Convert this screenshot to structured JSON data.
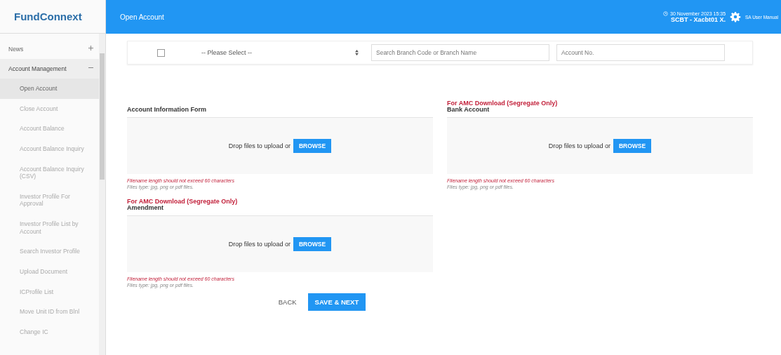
{
  "logo": "FundConnext",
  "header": {
    "page_title": "Open Account",
    "datetime": "30 November 2023 15:35",
    "user": "SCBT - Xacbt01 X.",
    "manual_link": "SA User Manual"
  },
  "sidebar": {
    "items": [
      {
        "label": "News",
        "expanded": false,
        "selected": false
      },
      {
        "label": "Account Management",
        "expanded": true,
        "selected": false,
        "children": [
          {
            "label": "Open Account",
            "selected": true
          },
          {
            "label": "Close Account",
            "selected": false
          },
          {
            "label": "Account Balance",
            "selected": false
          },
          {
            "label": "Account Balance Inquiry",
            "selected": false
          },
          {
            "label": "Account Balance Inquiry (CSV)",
            "selected": false
          },
          {
            "label": "Investor Profile For Approval",
            "selected": false
          },
          {
            "label": "Investor Profile List by Account",
            "selected": false
          },
          {
            "label": "Search Investor Profile",
            "selected": false
          },
          {
            "label": "Upload Document",
            "selected": false
          },
          {
            "label": "ICProfile List",
            "selected": false
          },
          {
            "label": "Move Unit ID from Blnl",
            "selected": false
          },
          {
            "label": "Change IC",
            "selected": false
          }
        ]
      }
    ]
  },
  "bank_row": {
    "checked": false,
    "select": "-- Please Select --",
    "branch_placeholder": "Search Branch Code or Branch Name",
    "account_placeholder": "Account No."
  },
  "uploads": [
    {
      "label": "Account Information Form",
      "drop_text": "Drop files to upload or",
      "browse": "BROWSE",
      "rule": "Filename length should not exceed 60 characters",
      "types": "Files type: jpg, png or pdf files."
    },
    {
      "note": "For AMC Download (Segregate Only)",
      "label": "Bank Account",
      "drop_text": "Drop files to upload or",
      "browse": "BROWSE",
      "rule": "Filename length should not exceed 60 characters",
      "types": "Files type: jpg, png or pdf files."
    },
    {
      "note": "For AMC Download (Segregate Only)",
      "label": "Amendment",
      "drop_text": "Drop files to upload or",
      "browse": "BROWSE",
      "rule": "Filename length should not exceed 60 characters",
      "types": "Files type: jpg, png or pdf files."
    }
  ],
  "actions": {
    "back": "BACK",
    "next": "SAVE & NEXT"
  }
}
